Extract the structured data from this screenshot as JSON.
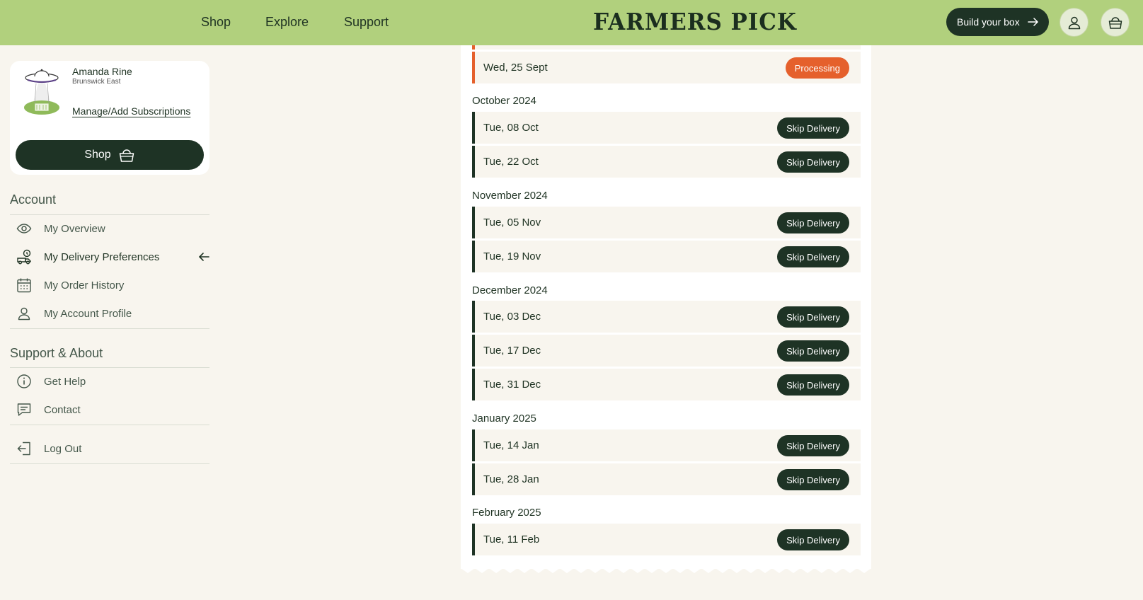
{
  "header": {
    "nav": [
      "Shop",
      "Explore",
      "Support"
    ],
    "logo": "FARMERS PICK",
    "build_box": "Build your box",
    "account_icon": "user-icon",
    "cart_icon": "basket-icon"
  },
  "profile": {
    "name": "Amanda Rine",
    "suburb": "Brunswick East",
    "manage_link": "Manage/Add Subscriptions",
    "shop_button": "Shop"
  },
  "account": {
    "title": "Account",
    "items": [
      {
        "label": "My Overview",
        "icon": "eye-icon"
      },
      {
        "label": "My Delivery Preferences",
        "icon": "delivery-truck-icon",
        "active": true
      },
      {
        "label": "My Order History",
        "icon": "calendar-icon"
      },
      {
        "label": "My Account Profile",
        "icon": "user-icon"
      }
    ]
  },
  "support": {
    "title": "Support & About",
    "items": [
      {
        "label": "Get Help",
        "icon": "info-icon"
      },
      {
        "label": "Contact",
        "icon": "chat-icon"
      }
    ],
    "logout": "Log Out"
  },
  "deliveries": {
    "processing_row": {
      "date": "Wed, 25 Sept",
      "status": "Processing"
    },
    "skip_label": "Skip Delivery",
    "months": [
      {
        "title": "October 2024",
        "dates": [
          "Tue, 08 Oct",
          "Tue, 22 Oct"
        ]
      },
      {
        "title": "November 2024",
        "dates": [
          "Tue, 05 Nov",
          "Tue, 19 Nov"
        ]
      },
      {
        "title": "December 2024",
        "dates": [
          "Tue, 03 Dec",
          "Tue, 17 Dec",
          "Tue, 31 Dec"
        ]
      },
      {
        "title": "January 2025",
        "dates": [
          "Tue, 14 Jan",
          "Tue, 28 Jan"
        ]
      },
      {
        "title": "February 2025",
        "dates": [
          "Tue, 11 Feb"
        ]
      }
    ]
  },
  "colors": {
    "header_bg": "#b1d07d",
    "dark_green": "#1e3325",
    "processing_orange": "#e5602c",
    "page_bg": "#f8f5ee"
  }
}
